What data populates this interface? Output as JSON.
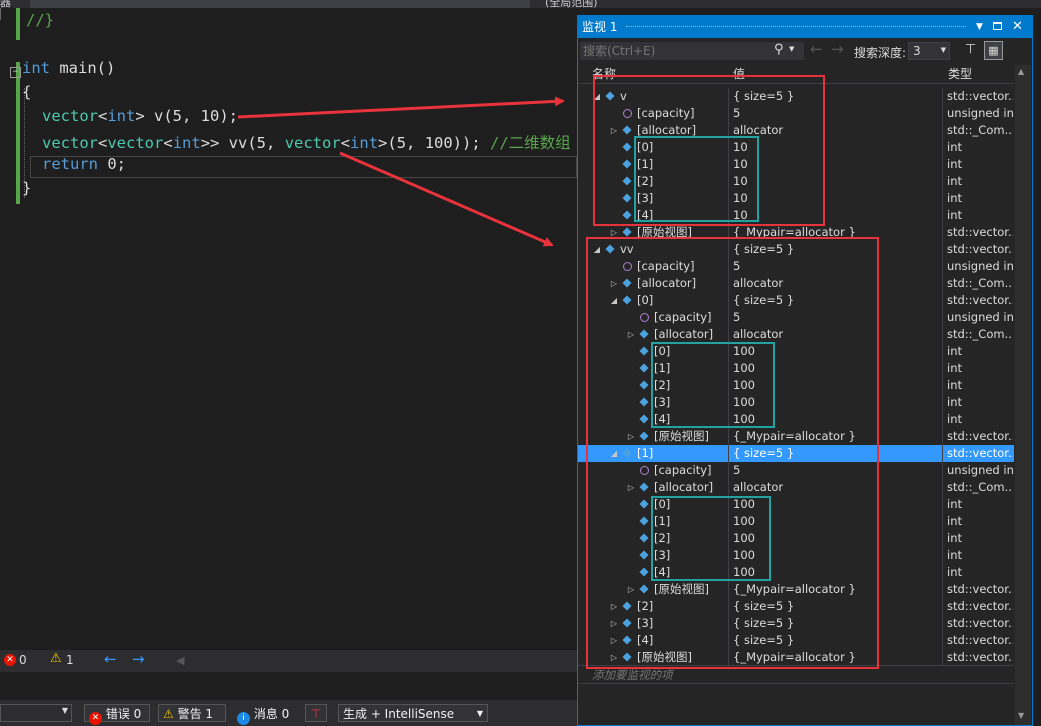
{
  "editor": {
    "partial_tab": "器",
    "scope_label": "(全局范围)",
    "lines": [
      {
        "parts": [
          {
            "t": "//}",
            "c": "cm"
          }
        ]
      },
      {
        "parts": []
      },
      {
        "parts": [
          {
            "t": "int",
            "c": "kw"
          },
          {
            "t": " main()",
            "c": ""
          }
        ]
      },
      {
        "parts": [
          {
            "t": "{",
            "c": ""
          }
        ]
      },
      {
        "parts": [
          {
            "t": "vector",
            "c": "ty"
          },
          {
            "t": "<",
            "c": ""
          },
          {
            "t": "int",
            "c": "kw"
          },
          {
            "t": "> v(5, 10);",
            "c": ""
          }
        ]
      },
      {
        "parts": [
          {
            "t": "vector",
            "c": "ty"
          },
          {
            "t": "<",
            "c": ""
          },
          {
            "t": "vector",
            "c": "ty"
          },
          {
            "t": "<",
            "c": ""
          },
          {
            "t": "int",
            "c": "kw"
          },
          {
            "t": ">> vv(5, ",
            "c": ""
          },
          {
            "t": "vector",
            "c": "ty"
          },
          {
            "t": "<",
            "c": ""
          },
          {
            "t": "int",
            "c": "kw"
          },
          {
            "t": ">(5, 100)); ",
            "c": ""
          },
          {
            "t": "//二维数组",
            "c": "cm"
          }
        ]
      },
      {
        "parts": [
          {
            "t": "return",
            "c": "kw"
          },
          {
            "t": " 0;",
            "c": ""
          }
        ]
      },
      {
        "parts": [
          {
            "t": "}",
            "c": ""
          }
        ]
      }
    ]
  },
  "status": {
    "errors": "0",
    "warnings": "1"
  },
  "error_list": {
    "errors_label": "错误 0",
    "warnings_label": "警告 1",
    "messages_label": "消息 0",
    "build_filter": "生成 + IntelliSense"
  },
  "watch": {
    "title": "监视 1",
    "search_placeholder": "搜索(Ctrl+E)",
    "depth_label": "搜索深度:",
    "depth_value": "3",
    "col_name": "名称",
    "col_value": "值",
    "col_type": "类型",
    "add_item": "添加要监视的项",
    "rows": [
      {
        "d": 0,
        "exp": "open",
        "icon": "cube",
        "name": "v",
        "value": "{ size=5 }",
        "type": "std::vector..."
      },
      {
        "d": 1,
        "exp": "none",
        "icon": "purple",
        "name": "[capacity]",
        "value": "5",
        "type": "unsigned int"
      },
      {
        "d": 1,
        "exp": "closed",
        "icon": "cube",
        "name": "[allocator]",
        "value": "allocator",
        "type": "std::_Com..."
      },
      {
        "d": 1,
        "exp": "none",
        "icon": "cube",
        "name": "[0]",
        "value": "10",
        "type": "int"
      },
      {
        "d": 1,
        "exp": "none",
        "icon": "cube",
        "name": "[1]",
        "value": "10",
        "type": "int"
      },
      {
        "d": 1,
        "exp": "none",
        "icon": "cube",
        "name": "[2]",
        "value": "10",
        "type": "int"
      },
      {
        "d": 1,
        "exp": "none",
        "icon": "cube",
        "name": "[3]",
        "value": "10",
        "type": "int"
      },
      {
        "d": 1,
        "exp": "none",
        "icon": "cube",
        "name": "[4]",
        "value": "10",
        "type": "int"
      },
      {
        "d": 1,
        "exp": "closed",
        "icon": "cube",
        "name": "[原始视图]",
        "value": "{_Mypair=allocator }",
        "type": "std::vector..."
      },
      {
        "d": 0,
        "exp": "open",
        "icon": "cube",
        "name": "vv",
        "value": "{ size=5 }",
        "type": "std::vector..."
      },
      {
        "d": 1,
        "exp": "none",
        "icon": "purple",
        "name": "[capacity]",
        "value": "5",
        "type": "unsigned int"
      },
      {
        "d": 1,
        "exp": "closed",
        "icon": "cube",
        "name": "[allocator]",
        "value": "allocator",
        "type": "std::_Com..."
      },
      {
        "d": 1,
        "exp": "open",
        "icon": "cube",
        "name": "[0]",
        "value": "{ size=5 }",
        "type": "std::vector..."
      },
      {
        "d": 2,
        "exp": "none",
        "icon": "purple",
        "name": "[capacity]",
        "value": "5",
        "type": "unsigned int"
      },
      {
        "d": 2,
        "exp": "closed",
        "icon": "cube",
        "name": "[allocator]",
        "value": "allocator",
        "type": "std::_Com..."
      },
      {
        "d": 2,
        "exp": "none",
        "icon": "cube",
        "name": "[0]",
        "value": "100",
        "type": "int"
      },
      {
        "d": 2,
        "exp": "none",
        "icon": "cube",
        "name": "[1]",
        "value": "100",
        "type": "int"
      },
      {
        "d": 2,
        "exp": "none",
        "icon": "cube",
        "name": "[2]",
        "value": "100",
        "type": "int"
      },
      {
        "d": 2,
        "exp": "none",
        "icon": "cube",
        "name": "[3]",
        "value": "100",
        "type": "int"
      },
      {
        "d": 2,
        "exp": "none",
        "icon": "cube",
        "name": "[4]",
        "value": "100",
        "type": "int"
      },
      {
        "d": 2,
        "exp": "closed",
        "icon": "cube",
        "name": "[原始视图]",
        "value": "{_Mypair=allocator }",
        "type": "std::vector..."
      },
      {
        "d": 1,
        "exp": "open",
        "icon": "cube",
        "name": "[1]",
        "value": "{ size=5 }",
        "type": "std::vector...",
        "sel": true
      },
      {
        "d": 2,
        "exp": "none",
        "icon": "purple",
        "name": "[capacity]",
        "value": "5",
        "type": "unsigned int"
      },
      {
        "d": 2,
        "exp": "closed",
        "icon": "cube",
        "name": "[allocator]",
        "value": "allocator",
        "type": "std::_Com..."
      },
      {
        "d": 2,
        "exp": "none",
        "icon": "cube",
        "name": "[0]",
        "value": "100",
        "type": "int"
      },
      {
        "d": 2,
        "exp": "none",
        "icon": "cube",
        "name": "[1]",
        "value": "100",
        "type": "int"
      },
      {
        "d": 2,
        "exp": "none",
        "icon": "cube",
        "name": "[2]",
        "value": "100",
        "type": "int"
      },
      {
        "d": 2,
        "exp": "none",
        "icon": "cube",
        "name": "[3]",
        "value": "100",
        "type": "int"
      },
      {
        "d": 2,
        "exp": "none",
        "icon": "cube",
        "name": "[4]",
        "value": "100",
        "type": "int"
      },
      {
        "d": 2,
        "exp": "closed",
        "icon": "cube",
        "name": "[原始视图]",
        "value": "{_Mypair=allocator }",
        "type": "std::vector..."
      },
      {
        "d": 1,
        "exp": "closed",
        "icon": "cube",
        "name": "[2]",
        "value": "{ size=5 }",
        "type": "std::vector..."
      },
      {
        "d": 1,
        "exp": "closed",
        "icon": "cube",
        "name": "[3]",
        "value": "{ size=5 }",
        "type": "std::vector..."
      },
      {
        "d": 1,
        "exp": "closed",
        "icon": "cube",
        "name": "[4]",
        "value": "{ size=5 }",
        "type": "std::vector..."
      },
      {
        "d": 1,
        "exp": "closed",
        "icon": "cube",
        "name": "[原始视图]",
        "value": "{_Mypair=allocator }",
        "type": "std::vector..."
      }
    ]
  },
  "colors": {
    "accent": "#007acc",
    "annotation_red": "#e8323c",
    "annotation_teal": "#21a3a3",
    "selection": "#3399ff"
  }
}
